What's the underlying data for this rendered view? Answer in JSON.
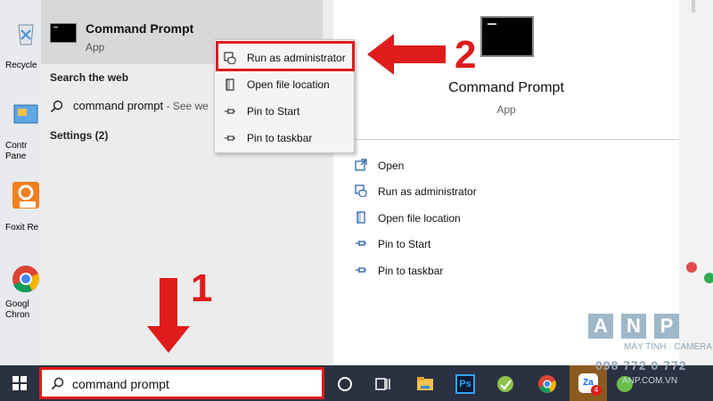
{
  "desktop": {
    "icons": [
      {
        "label": "Recycle",
        "icon": "recycle-bin-icon"
      },
      {
        "label": "Contr Pane",
        "icon": "control-panel-icon"
      },
      {
        "label": "Foxit Re",
        "icon": "foxit-pdf-icon"
      },
      {
        "label": "Googl Chron",
        "icon": "google-chrome-icon"
      }
    ]
  },
  "start_menu": {
    "best_match": {
      "title": "Command Prompt",
      "subtitle": "App",
      "icon": "command-prompt-icon"
    },
    "search_web_header": "Search the web",
    "web_result": {
      "text": "command prompt",
      "suffix": " - See we"
    },
    "settings_header": "Settings (2)"
  },
  "context_menu": {
    "items": [
      {
        "label": "Run as administrator",
        "icon": "shield-icon"
      },
      {
        "label": "Open file location",
        "icon": "folder-icon"
      },
      {
        "label": "Pin to Start",
        "icon": "pin-icon"
      },
      {
        "label": "Pin to taskbar",
        "icon": "pin-icon"
      }
    ]
  },
  "detail": {
    "title": "Command Prompt",
    "subtitle": "App",
    "actions": [
      {
        "label": "Open",
        "icon": "open-icon"
      },
      {
        "label": "Run as administrator",
        "icon": "shield-icon"
      },
      {
        "label": "Open file location",
        "icon": "folder-icon"
      },
      {
        "label": "Pin to Start",
        "icon": "pin-icon"
      },
      {
        "label": "Pin to taskbar",
        "icon": "pin-icon"
      }
    ]
  },
  "annotations": {
    "step1": "1",
    "step2": "2"
  },
  "taskbar": {
    "search_value": "command prompt",
    "icons": [
      "cortana-icon",
      "task-view-icon",
      "file-explorer-icon",
      "photoshop-icon",
      "app-icon",
      "chrome-icon",
      "zalo-icon",
      "app-icon"
    ],
    "photoshop_label": "Ps",
    "zalo_label": "Za",
    "zalo_badge": "4"
  },
  "watermark": {
    "letters": [
      "A",
      "N",
      "P"
    ],
    "tagline": "MÁY TÍNH · CAMERA",
    "phone": "098 772 0 772",
    "url": "ANP.COM.VN"
  },
  "colors": {
    "highlight": "#e01b1b",
    "taskbar": "#2a3140",
    "menu_bg": "#ececec",
    "selected": "#d8d8d8"
  }
}
